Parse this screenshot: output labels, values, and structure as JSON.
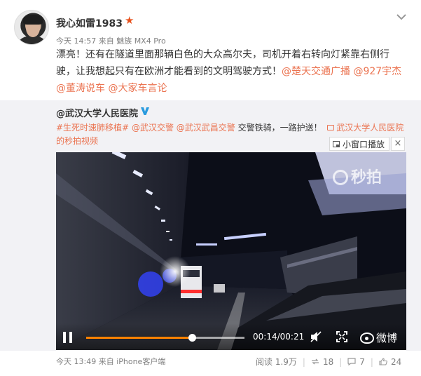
{
  "post": {
    "username": "我心如雷1983",
    "time": "今天 14:57",
    "source": "来自 魅族 MX4 Pro",
    "text_before": "漂亮！还有在隧道里面那辆白色的大众高尔夫，司机开着右转向灯紧靠右侧行驶，让我想起只有在欧洲才能看到的文明驾驶方式！",
    "mentions": [
      "@楚天交通广播",
      "@927宇杰",
      "@董涛说车",
      "@大家车言论"
    ]
  },
  "repost": {
    "original_user": "@武汉大学人民医院",
    "hashtag": "#生死时速肺移植#",
    "mention1": "@武汉交警",
    "mention2": "@武汉武昌交警",
    "text": " 交警铁骑，一路护送！",
    "video_link": "武汉大学人民医院的秒拍视频",
    "mini_window_label": "小窗口播放",
    "close_label": "×",
    "video": {
      "watermark": "秒拍",
      "time_display": "00:14/00:21",
      "progress": 0.667,
      "brand": "微博"
    },
    "time": "今天 13:49",
    "source": "来自 iPhone客户端",
    "stats": {
      "reads": "阅读 1.9万",
      "reposts": "18",
      "comments": "7",
      "likes": "24"
    }
  },
  "colors": {
    "link": "#eb7350",
    "progress": "#ff8200",
    "verified_badge": "#2a9bde",
    "vip_star": "#e8511c"
  }
}
